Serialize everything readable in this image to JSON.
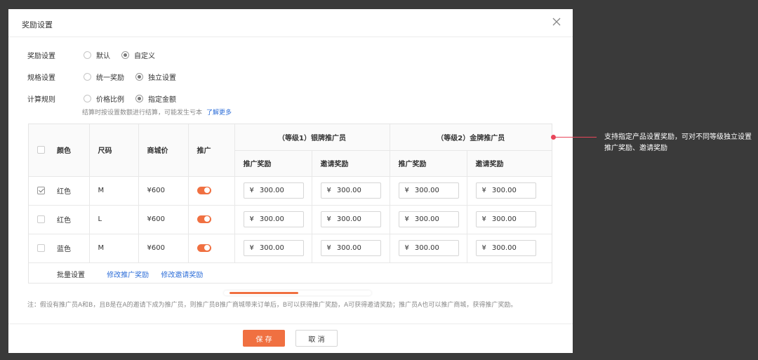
{
  "modal": {
    "title": "奖励设置"
  },
  "form": {
    "reward": {
      "label": "奖励设置",
      "options": [
        "默认",
        "自定义"
      ],
      "selected": 1
    },
    "spec": {
      "label": "规格设置",
      "options": [
        "统一奖励",
        "独立设置"
      ],
      "selected": 1
    },
    "calc": {
      "label": "计算规则",
      "options": [
        "价格比例",
        "指定金额"
      ],
      "selected": 1
    },
    "hint": "结算时按设置数额进行结算，可能发生亏本",
    "hint_link": "了解更多"
  },
  "table": {
    "headers": {
      "color": "颜色",
      "size": "尺码",
      "price": "商城价",
      "promote": "推广"
    },
    "groups": [
      "（等级1）银牌推广员",
      "（等级2）金牌推广员"
    ],
    "sub_headers": [
      "推广奖励",
      "邀请奖励",
      "推广奖励",
      "邀请奖励"
    ],
    "rows": [
      {
        "checked": true,
        "color": "红色",
        "size": "M",
        "price": "¥600",
        "values": [
          "300.00",
          "300.00",
          "300.00",
          "300.00"
        ]
      },
      {
        "checked": false,
        "color": "红色",
        "size": "L",
        "price": "¥600",
        "values": [
          "300.00",
          "300.00",
          "300.00",
          "300.00"
        ]
      },
      {
        "checked": false,
        "color": "蓝色",
        "size": "M",
        "price": "¥600",
        "values": [
          "300.00",
          "300.00",
          "300.00",
          "300.00"
        ]
      }
    ],
    "currency": "¥",
    "batch": {
      "label": "批量设置",
      "link1": "修改推广奖励",
      "link2": "修改邀请奖励"
    }
  },
  "note": "注：假设有推广员A和B，且B是在A的邀请下成为推广员，则推广员B推广商城带来订单后，B可以获得推广奖励，A可获得邀请奖励；推广员A也可以推广商城，获得推广奖励。",
  "footer": {
    "save": "保 存",
    "cancel": "取 消"
  },
  "callout": "支持指定产品设置奖励，可对不同等级独立设置推广奖励、邀请奖励",
  "colors": {
    "accent": "#f07041",
    "link": "#2f6fd8",
    "callout": "#e8465a"
  }
}
